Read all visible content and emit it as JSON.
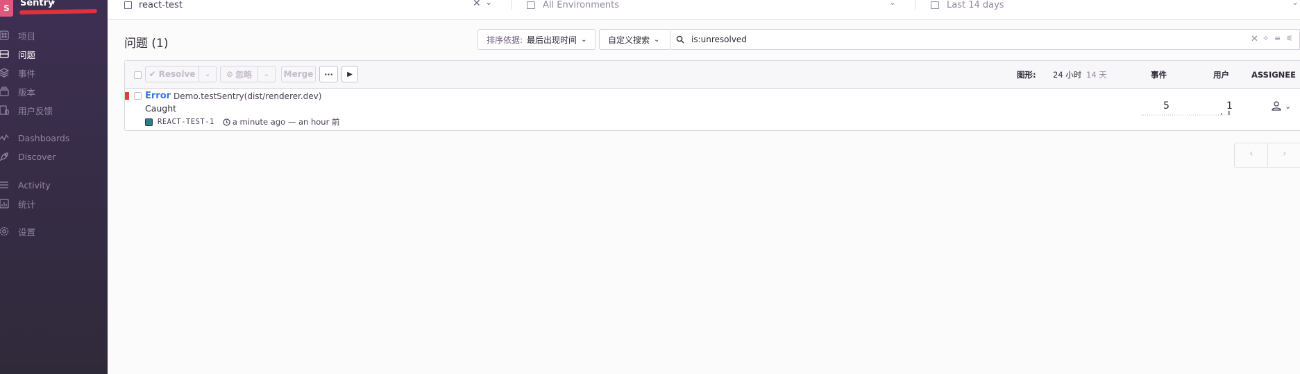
{
  "sidebar": {
    "org_initial": "S",
    "org_name": "Sentry",
    "items": [
      {
        "label": "项目",
        "icon": "projects-icon"
      },
      {
        "label": "问题",
        "icon": "issues-icon",
        "active": true
      },
      {
        "label": "事件",
        "icon": "events-icon"
      },
      {
        "label": "版本",
        "icon": "releases-icon"
      },
      {
        "label": "用户反馈",
        "icon": "user-feedback-icon"
      },
      {
        "label": "Dashboards",
        "icon": "dashboards-icon"
      },
      {
        "label": "Discover",
        "icon": "discover-icon"
      },
      {
        "label": "Activity",
        "icon": "activity-icon"
      },
      {
        "label": "统计",
        "icon": "stats-icon"
      },
      {
        "label": "设置",
        "icon": "settings-icon"
      }
    ]
  },
  "topbar": {
    "project": "react-test",
    "environment": "All Environments",
    "period": "Last 14 days"
  },
  "header": {
    "title": "问题 (1)",
    "sort_label": "排序依据:",
    "sort_value": "最后出现时间",
    "saved_search": "自定义搜索",
    "search_value": "is:unresolved"
  },
  "actions": {
    "resolve": "Resolve",
    "ignore": "忽略",
    "merge": "Merge",
    "more": "···"
  },
  "columns": {
    "graph_label": "图形:",
    "graph_24h": "24 小时",
    "graph_14d": "14 天",
    "events": "事件",
    "users": "用户",
    "assignee": "ASSIGNEE"
  },
  "issues": [
    {
      "title": "Error",
      "culprit": "Demo.testSentry(dist/renderer.dev)",
      "message": "Caught",
      "short_id": "REACT-TEST-1",
      "time": "a minute ago — an hour 前",
      "events": "5",
      "users": "1"
    }
  ],
  "colors": {
    "sidebar_top": "#3d2f52",
    "accent": "#3d74db",
    "level_error": "#e03e2f",
    "org_avatar": "#e1567c"
  }
}
